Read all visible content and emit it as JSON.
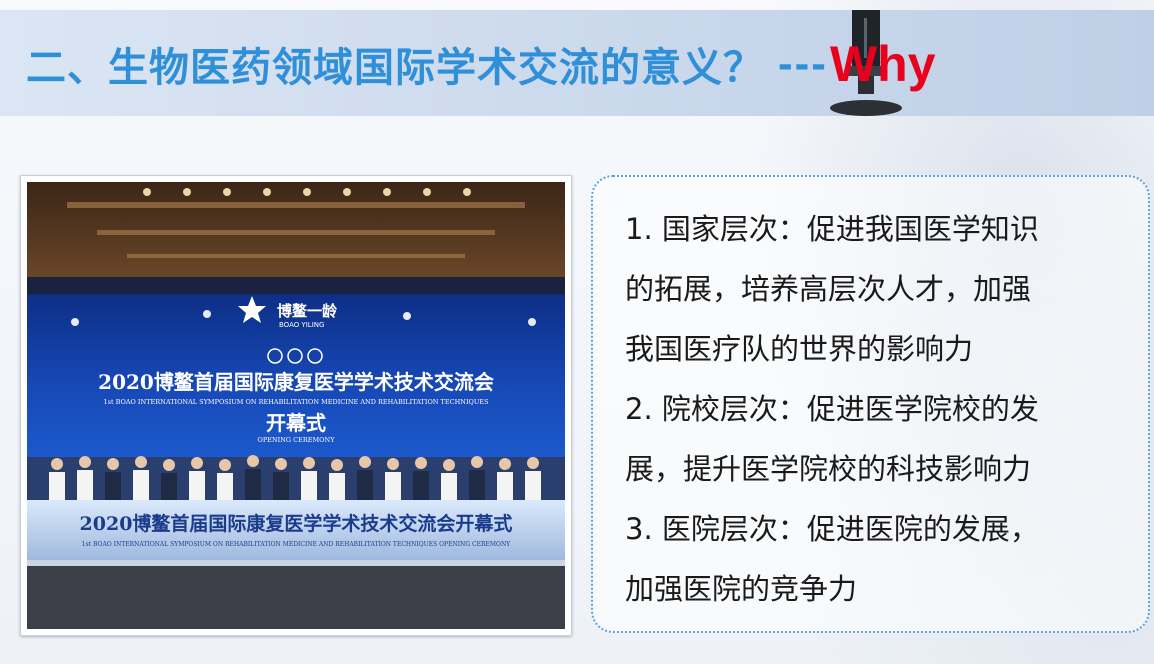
{
  "header": {
    "title_main": "二、生物医药领域国际学术交流的意义？",
    "title_dash": "---",
    "title_why": "Why"
  },
  "photo": {
    "brand_cn": "博鳌一龄",
    "brand_en": "BOAO YILING",
    "banner_cn": "2020博鳌首届国际康复医学学术技术交流会",
    "banner_en": "1st BOAO INTERNATIONAL SYMPOSIUM ON REHABILITATION MEDICINE AND REHABILITATION TECHNIQUES",
    "banner_ceremony_cn": "开幕式",
    "banner_ceremony_en": "OPENING CEREMONY",
    "stage_cn": "2020博鳌首届国际康复医学学术技术交流会开幕式",
    "stage_en": "1st BOAO INTERNATIONAL SYMPOSIUM ON REHABILITATION MEDICINE AND REHABILITATION TECHNIQUES OPENING CEREMONY"
  },
  "panel": {
    "lines": [
      "1. 国家层次：促进我国医学知识",
      "的拓展，培养高层次人才，加强",
      "我国医疗队的世界的影响力",
      "2. 院校层次：促进医学院校的发",
      "展，提升医学院校的科技影响力",
      "3. 医院层次：促进医院的发展，",
      "加强医院的竞争力"
    ]
  },
  "colors": {
    "title_blue": "#2f8fd8",
    "why_red": "#e8001c",
    "panel_border": "#5aa2e0"
  }
}
